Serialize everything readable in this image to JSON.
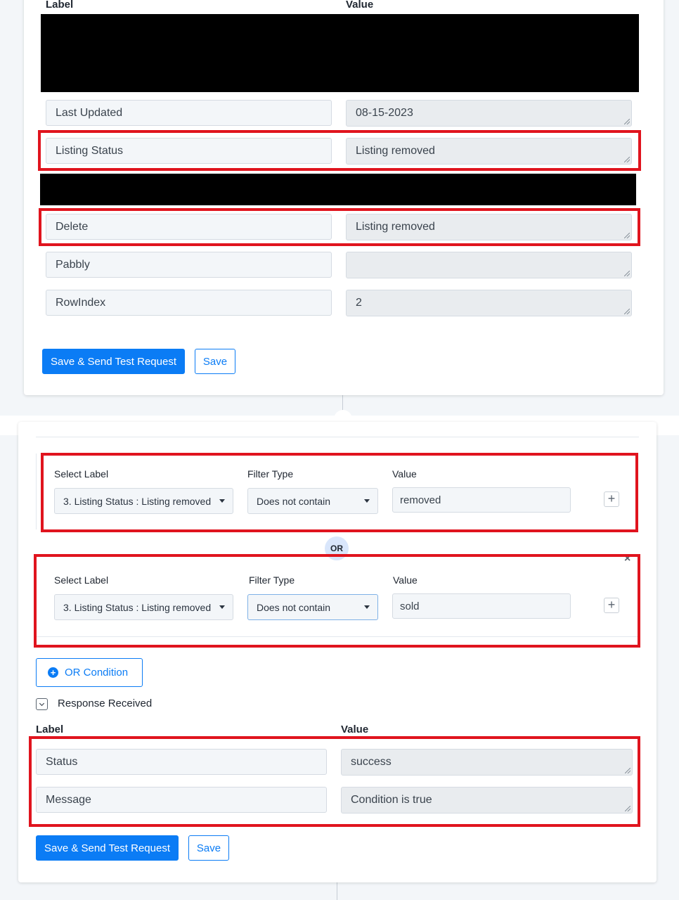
{
  "top_section": {
    "header_label": "Label",
    "header_value": "Value",
    "rows": [
      {
        "label": "Last Updated",
        "value": "08-15-2023"
      },
      {
        "label": "Listing Status",
        "value": "Listing removed"
      },
      {
        "label": "Delete",
        "value": "Listing removed"
      },
      {
        "label": "Pabbly",
        "value": ""
      },
      {
        "label": "RowIndex",
        "value": "2"
      }
    ],
    "save_send_label": "Save & Send Test Request",
    "save_label": "Save"
  },
  "filter": {
    "conditions": [
      {
        "select_label_title": "Select Label",
        "select_label_value": "3. Listing Status : Listing removed",
        "filter_type_title": "Filter Type",
        "filter_type_value": "Does not contain",
        "value_title": "Value",
        "value": "removed"
      },
      {
        "select_label_title": "Select Label",
        "select_label_value": "3. Listing Status : Listing removed",
        "filter_type_title": "Filter Type",
        "filter_type_value": "Does not contain",
        "value_title": "Value",
        "value": "sold"
      }
    ],
    "or_separator": "OR",
    "close_symbol": "×",
    "add_symbol": "+",
    "or_condition_label": "OR Condition"
  },
  "response": {
    "toggle_label": "Response Received",
    "header_label": "Label",
    "header_value": "Value",
    "rows": [
      {
        "label": "Status",
        "value": "success"
      },
      {
        "label": "Message",
        "value": "Condition is true"
      }
    ],
    "save_send_label": "Save & Send Test Request",
    "save_label": "Save"
  },
  "colors": {
    "accent": "#0b7cf5",
    "highlight": "#e0141e",
    "redaction": "#000000"
  }
}
